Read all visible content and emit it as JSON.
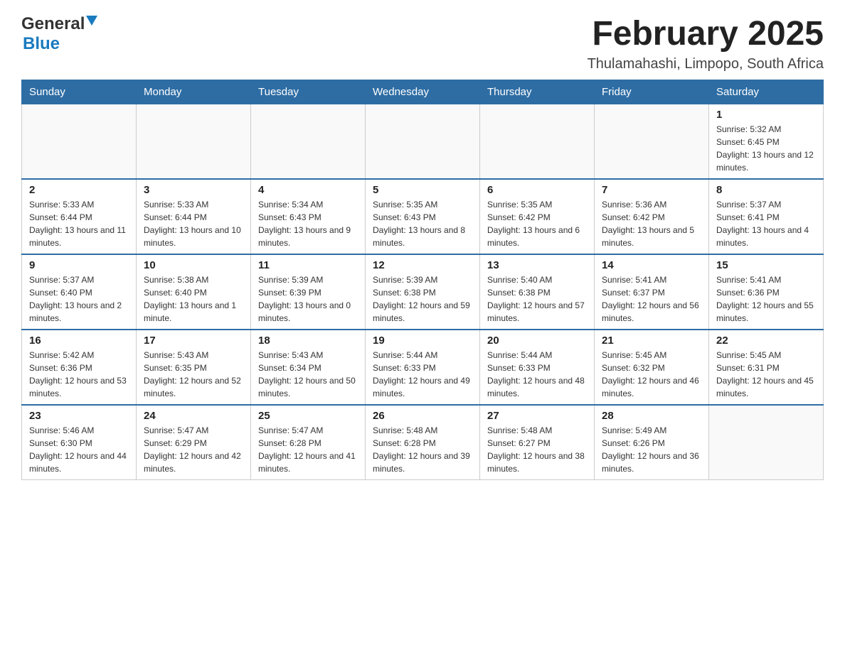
{
  "header": {
    "logo_general": "General",
    "logo_blue": "Blue",
    "title": "February 2025",
    "subtitle": "Thulamahashi, Limpopo, South Africa"
  },
  "weekdays": [
    "Sunday",
    "Monday",
    "Tuesday",
    "Wednesday",
    "Thursday",
    "Friday",
    "Saturday"
  ],
  "weeks": [
    [
      {
        "day": "",
        "info": ""
      },
      {
        "day": "",
        "info": ""
      },
      {
        "day": "",
        "info": ""
      },
      {
        "day": "",
        "info": ""
      },
      {
        "day": "",
        "info": ""
      },
      {
        "day": "",
        "info": ""
      },
      {
        "day": "1",
        "info": "Sunrise: 5:32 AM\nSunset: 6:45 PM\nDaylight: 13 hours and 12 minutes."
      }
    ],
    [
      {
        "day": "2",
        "info": "Sunrise: 5:33 AM\nSunset: 6:44 PM\nDaylight: 13 hours and 11 minutes."
      },
      {
        "day": "3",
        "info": "Sunrise: 5:33 AM\nSunset: 6:44 PM\nDaylight: 13 hours and 10 minutes."
      },
      {
        "day": "4",
        "info": "Sunrise: 5:34 AM\nSunset: 6:43 PM\nDaylight: 13 hours and 9 minutes."
      },
      {
        "day": "5",
        "info": "Sunrise: 5:35 AM\nSunset: 6:43 PM\nDaylight: 13 hours and 8 minutes."
      },
      {
        "day": "6",
        "info": "Sunrise: 5:35 AM\nSunset: 6:42 PM\nDaylight: 13 hours and 6 minutes."
      },
      {
        "day": "7",
        "info": "Sunrise: 5:36 AM\nSunset: 6:42 PM\nDaylight: 13 hours and 5 minutes."
      },
      {
        "day": "8",
        "info": "Sunrise: 5:37 AM\nSunset: 6:41 PM\nDaylight: 13 hours and 4 minutes."
      }
    ],
    [
      {
        "day": "9",
        "info": "Sunrise: 5:37 AM\nSunset: 6:40 PM\nDaylight: 13 hours and 2 minutes."
      },
      {
        "day": "10",
        "info": "Sunrise: 5:38 AM\nSunset: 6:40 PM\nDaylight: 13 hours and 1 minute."
      },
      {
        "day": "11",
        "info": "Sunrise: 5:39 AM\nSunset: 6:39 PM\nDaylight: 13 hours and 0 minutes."
      },
      {
        "day": "12",
        "info": "Sunrise: 5:39 AM\nSunset: 6:38 PM\nDaylight: 12 hours and 59 minutes."
      },
      {
        "day": "13",
        "info": "Sunrise: 5:40 AM\nSunset: 6:38 PM\nDaylight: 12 hours and 57 minutes."
      },
      {
        "day": "14",
        "info": "Sunrise: 5:41 AM\nSunset: 6:37 PM\nDaylight: 12 hours and 56 minutes."
      },
      {
        "day": "15",
        "info": "Sunrise: 5:41 AM\nSunset: 6:36 PM\nDaylight: 12 hours and 55 minutes."
      }
    ],
    [
      {
        "day": "16",
        "info": "Sunrise: 5:42 AM\nSunset: 6:36 PM\nDaylight: 12 hours and 53 minutes."
      },
      {
        "day": "17",
        "info": "Sunrise: 5:43 AM\nSunset: 6:35 PM\nDaylight: 12 hours and 52 minutes."
      },
      {
        "day": "18",
        "info": "Sunrise: 5:43 AM\nSunset: 6:34 PM\nDaylight: 12 hours and 50 minutes."
      },
      {
        "day": "19",
        "info": "Sunrise: 5:44 AM\nSunset: 6:33 PM\nDaylight: 12 hours and 49 minutes."
      },
      {
        "day": "20",
        "info": "Sunrise: 5:44 AM\nSunset: 6:33 PM\nDaylight: 12 hours and 48 minutes."
      },
      {
        "day": "21",
        "info": "Sunrise: 5:45 AM\nSunset: 6:32 PM\nDaylight: 12 hours and 46 minutes."
      },
      {
        "day": "22",
        "info": "Sunrise: 5:45 AM\nSunset: 6:31 PM\nDaylight: 12 hours and 45 minutes."
      }
    ],
    [
      {
        "day": "23",
        "info": "Sunrise: 5:46 AM\nSunset: 6:30 PM\nDaylight: 12 hours and 44 minutes."
      },
      {
        "day": "24",
        "info": "Sunrise: 5:47 AM\nSunset: 6:29 PM\nDaylight: 12 hours and 42 minutes."
      },
      {
        "day": "25",
        "info": "Sunrise: 5:47 AM\nSunset: 6:28 PM\nDaylight: 12 hours and 41 minutes."
      },
      {
        "day": "26",
        "info": "Sunrise: 5:48 AM\nSunset: 6:28 PM\nDaylight: 12 hours and 39 minutes."
      },
      {
        "day": "27",
        "info": "Sunrise: 5:48 AM\nSunset: 6:27 PM\nDaylight: 12 hours and 38 minutes."
      },
      {
        "day": "28",
        "info": "Sunrise: 5:49 AM\nSunset: 6:26 PM\nDaylight: 12 hours and 36 minutes."
      },
      {
        "day": "",
        "info": ""
      }
    ]
  ]
}
